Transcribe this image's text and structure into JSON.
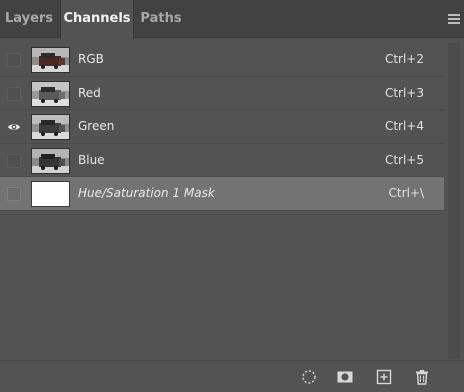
{
  "tabs": [
    {
      "label": "Layers"
    },
    {
      "label": "Channels"
    },
    {
      "label": "Paths"
    }
  ],
  "active_tab": "Channels",
  "channels": [
    {
      "name": "RGB",
      "shortcut": "Ctrl+2",
      "visible": false
    },
    {
      "name": "Red",
      "shortcut": "Ctrl+3",
      "visible": false
    },
    {
      "name": "Green",
      "shortcut": "Ctrl+4",
      "visible": true
    },
    {
      "name": "Blue",
      "shortcut": "Ctrl+5",
      "visible": false
    },
    {
      "name": "Hue/Saturation 1 Mask",
      "shortcut": "Ctrl+\\",
      "visible": false,
      "selected": true
    }
  ],
  "footer_icons": [
    "load-selection-icon",
    "save-selection-icon",
    "new-channel-icon",
    "delete-channel-icon"
  ],
  "colors": {
    "panel_bg": "#535353",
    "tabbar_bg": "#424242",
    "selected_row_bg": "#737373",
    "text": "#e8e8e8"
  }
}
